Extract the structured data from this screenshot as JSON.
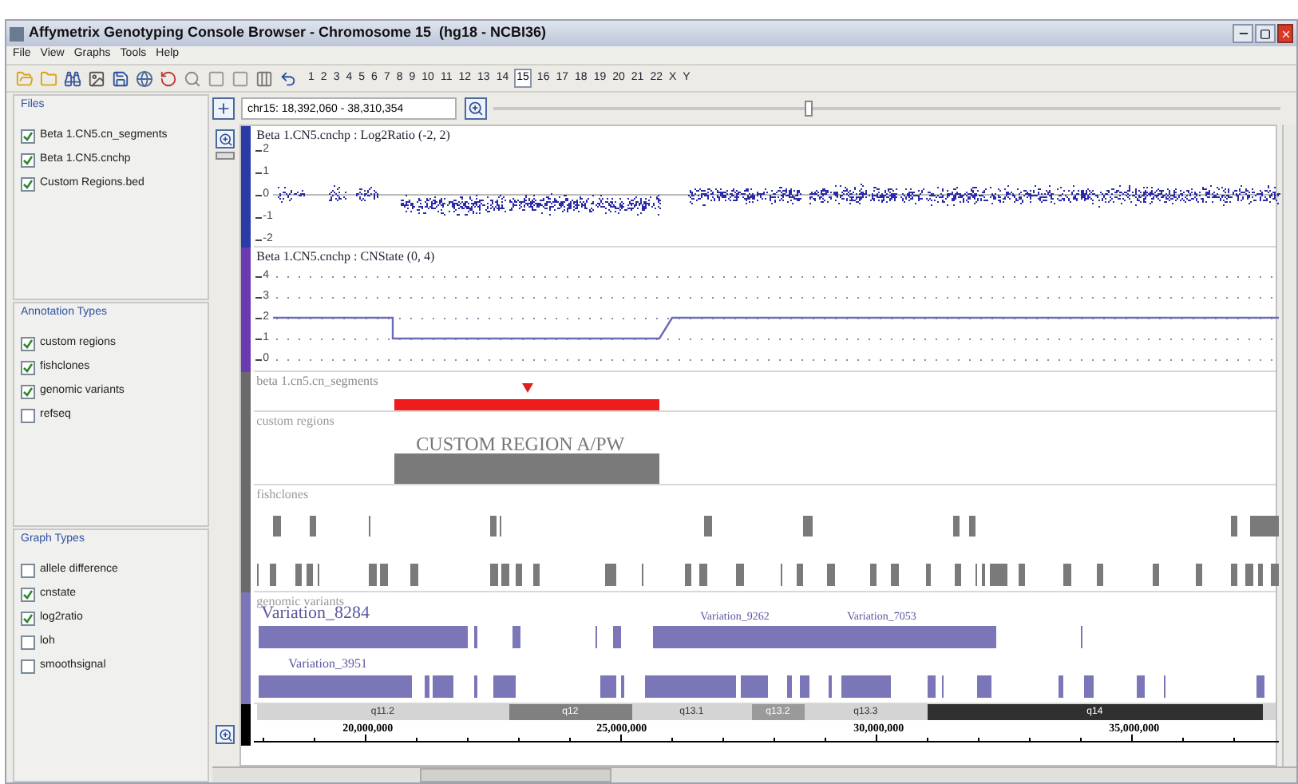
{
  "window": {
    "title": "Affymetrix Genotyping Console Browser - Chromosome 15  (hg18 - NCBI36)"
  },
  "menu": [
    "File",
    "View",
    "Graphs",
    "Tools",
    "Help"
  ],
  "chromosomes": [
    {
      "label": "1",
      "selected": false
    },
    {
      "label": "2",
      "selected": false
    },
    {
      "label": "3",
      "selected": false
    },
    {
      "label": "4",
      "selected": false
    },
    {
      "label": "5",
      "selected": false
    },
    {
      "label": "6",
      "selected": false
    },
    {
      "label": "7",
      "selected": false
    },
    {
      "label": "8",
      "selected": false
    },
    {
      "label": "9",
      "selected": false
    },
    {
      "label": "10",
      "selected": false
    },
    {
      "label": "11",
      "selected": false
    },
    {
      "label": "12",
      "selected": false
    },
    {
      "label": "13",
      "selected": false
    },
    {
      "label": "14",
      "selected": false
    },
    {
      "label": "15",
      "selected": true
    },
    {
      "label": "16",
      "selected": false
    },
    {
      "label": "17",
      "selected": false
    },
    {
      "label": "18",
      "selected": false
    },
    {
      "label": "19",
      "selected": false
    },
    {
      "label": "20",
      "selected": false
    },
    {
      "label": "21",
      "selected": false
    },
    {
      "label": "22",
      "selected": false
    },
    {
      "label": "X",
      "selected": false
    },
    {
      "label": "Y",
      "selected": false
    }
  ],
  "location": {
    "value": "chr15: 18,392,060 - 38,310,354"
  },
  "zoom": {
    "level": 0.4
  },
  "panels": [
    {
      "title": "Files",
      "items": [
        {
          "label": "Beta 1.CN5.cn_segments",
          "checked": true
        },
        {
          "label": "Beta 1.CN5.cnchp",
          "checked": true
        },
        {
          "label": "Custom Regions.bed",
          "checked": true
        }
      ]
    },
    {
      "title": "Annotation Types",
      "items": [
        {
          "label": "custom regions",
          "checked": true
        },
        {
          "label": "fishclones",
          "checked": true
        },
        {
          "label": "genomic variants",
          "checked": true
        },
        {
          "label": "refseq",
          "checked": false
        }
      ]
    },
    {
      "title": "Graph Types",
      "items": [
        {
          "label": "allele difference",
          "checked": false
        },
        {
          "label": "cnstate",
          "checked": true
        },
        {
          "label": "log2ratio",
          "checked": true
        },
        {
          "label": "loh",
          "checked": false
        },
        {
          "label": "smoothsignal",
          "checked": false
        }
      ]
    }
  ],
  "tracks": {
    "log2ratio": {
      "title": "Beta 1.CN5.cnchp : Log2Ratio (-2, 2)",
      "ticks": [
        "2",
        "1",
        "0",
        "-1",
        "-2"
      ]
    },
    "cnstate": {
      "title": "Beta 1.CN5.cnchp : CNState (0, 4)",
      "ticks": [
        "4",
        "3",
        "2",
        "1",
        "0"
      ]
    },
    "segments": {
      "title": "beta 1.cn5.cn_segments"
    },
    "custom_regions": {
      "title": "custom regions",
      "region_label": "CUSTOM REGION A/PW"
    },
    "fishclones": {
      "title": "fishclones"
    },
    "genomic_variants": {
      "title": "genomic variants",
      "labels": [
        "Variation_8284",
        "Variation_9262",
        "Variation_7053",
        "Variation_3951"
      ]
    },
    "cytobands": [
      {
        "label": "q11.2",
        "color": "#d4d4d4"
      },
      {
        "label": "q12",
        "color": "#808080"
      },
      {
        "label": "q13.1",
        "color": "#d4d4d4"
      },
      {
        "label": "q13.2",
        "color": "#9a9a9a"
      },
      {
        "label": "q13.3",
        "color": "#d4d4d4"
      },
      {
        "label": "q14",
        "color": "#303030"
      }
    ],
    "ruler": {
      "labels": [
        "20,000,000",
        "25,000,000",
        "30,000,000",
        "35,000,000"
      ]
    }
  }
}
